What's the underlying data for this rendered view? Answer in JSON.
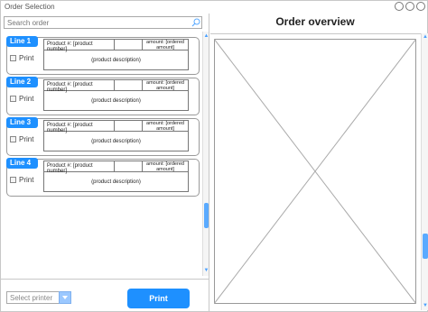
{
  "window": {
    "title": "Order Selection",
    "controls": [
      "minimize",
      "maximize",
      "close"
    ]
  },
  "search": {
    "placeholder": "Search order",
    "icon": "search-icon"
  },
  "lines": [
    {
      "label": "Line 1",
      "print_label": "Print",
      "product": "Product #: [product number]",
      "amount": "amount: [ordered amount]",
      "description": "(product description)"
    },
    {
      "label": "Line 2",
      "print_label": "Print",
      "product": "Product #: [product number]",
      "amount": "amount: [ordered amount]",
      "description": "(product description)"
    },
    {
      "label": "Line 3",
      "print_label": "Print",
      "product": "Product #: [product number]",
      "amount": "amount: [ordered amount]",
      "description": "(product description)"
    },
    {
      "label": "Line 4",
      "print_label": "Print",
      "product": "Product #: [product number]",
      "amount": "amount: [ordered amount]",
      "description": "(product description)"
    }
  ],
  "bottom": {
    "printer_placeholder": "Select printer",
    "print_button": "Print"
  },
  "overview": {
    "title": "Order overview"
  },
  "colors": {
    "accent": "#1e90ff",
    "scroll": "#5aaaff"
  }
}
